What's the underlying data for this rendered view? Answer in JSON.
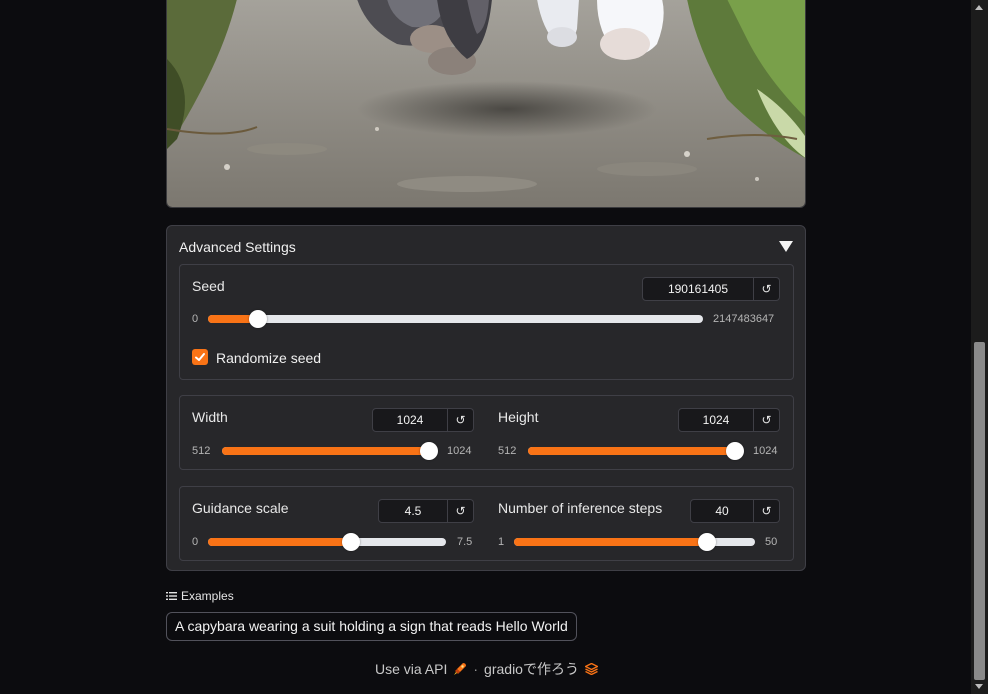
{
  "accordion": {
    "title": "Advanced Settings"
  },
  "seed": {
    "label": "Seed",
    "value": "190161405",
    "min": "0",
    "max": "2147483647",
    "position": 0.1,
    "reset_icon": "↺",
    "randomize_label": "Randomize seed",
    "randomize_checked": true
  },
  "width": {
    "label": "Width",
    "value": "1024",
    "min": "512",
    "max": "1024",
    "position": 1.0,
    "reset_icon": "↺"
  },
  "height": {
    "label": "Height",
    "value": "1024",
    "min": "512",
    "max": "1024",
    "position": 1.0,
    "reset_icon": "↺"
  },
  "guidance": {
    "label": "Guidance scale",
    "value": "4.5",
    "min": "0",
    "max": "7.5",
    "position": 0.6,
    "reset_icon": "↺"
  },
  "steps": {
    "label": "Number of inference steps",
    "value": "40",
    "min": "1",
    "max": "50",
    "position": 0.8,
    "reset_icon": "↺"
  },
  "examples": {
    "heading": "Examples",
    "items": [
      "A capybara wearing a suit holding a sign that reads Hello World"
    ]
  },
  "footer": {
    "api_label": "Use via API",
    "separator": "·",
    "gradio_label": "gradioで作ろう"
  },
  "colors": {
    "accent": "#f97316",
    "track": "#e5e7eb",
    "panel": "#27272a",
    "background": "#0c0c0f"
  }
}
